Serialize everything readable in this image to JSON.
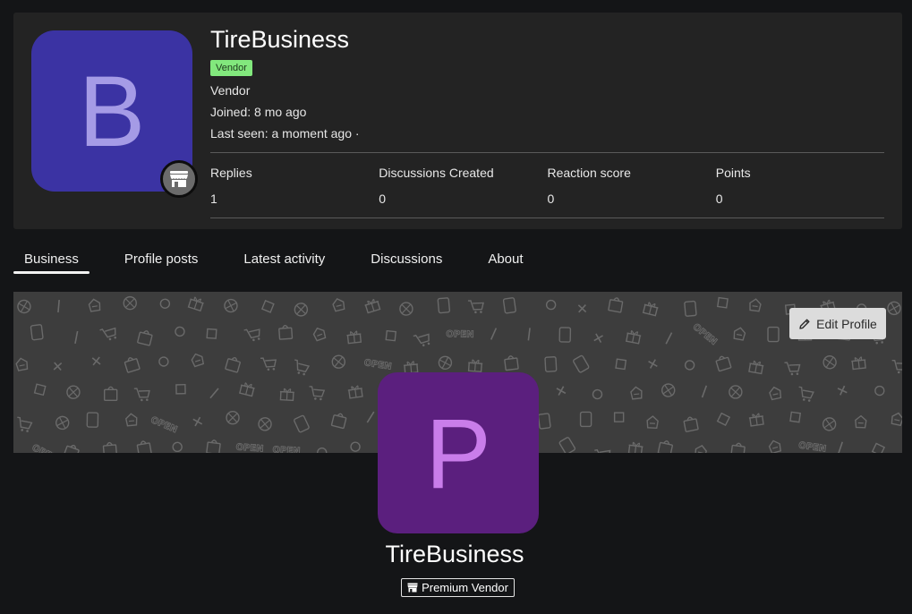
{
  "profile": {
    "avatar_letter": "B",
    "username": "TireBusiness",
    "banner_tag": "Vendor",
    "role": "Vendor",
    "joined_label": "Joined:",
    "joined_value": "8 mo ago",
    "last_seen_label": "Last seen:",
    "last_seen_value": "a moment ago ·",
    "badge_icon": "storefront-icon",
    "colors": {
      "avatar_bg": "#3b33a3",
      "avatar_letter": "#a59be6",
      "vendor_tag_bg": "#82e87d"
    }
  },
  "stats": [
    {
      "label": "Replies",
      "value": "1"
    },
    {
      "label": "Discussions Created",
      "value": "0"
    },
    {
      "label": "Reaction score",
      "value": "0"
    },
    {
      "label": "Points",
      "value": "0"
    }
  ],
  "tabs": [
    {
      "label": "Business",
      "active": true
    },
    {
      "label": "Profile posts",
      "active": false
    },
    {
      "label": "Latest activity",
      "active": false
    },
    {
      "label": "Discussions",
      "active": false
    },
    {
      "label": "About",
      "active": false
    }
  ],
  "business": {
    "edit_button": "Edit Profile",
    "edit_icon": "pencil-icon",
    "banner_pattern_text": "OPEN",
    "avatar_letter": "P",
    "name": "TireBusiness",
    "badge_label": "Premium Vendor",
    "badge_icon": "storefront-icon",
    "colors": {
      "avatar_bg": "#5b1f7e",
      "avatar_letter": "#c97dea",
      "banner_bg": "#3d3d3d"
    }
  }
}
